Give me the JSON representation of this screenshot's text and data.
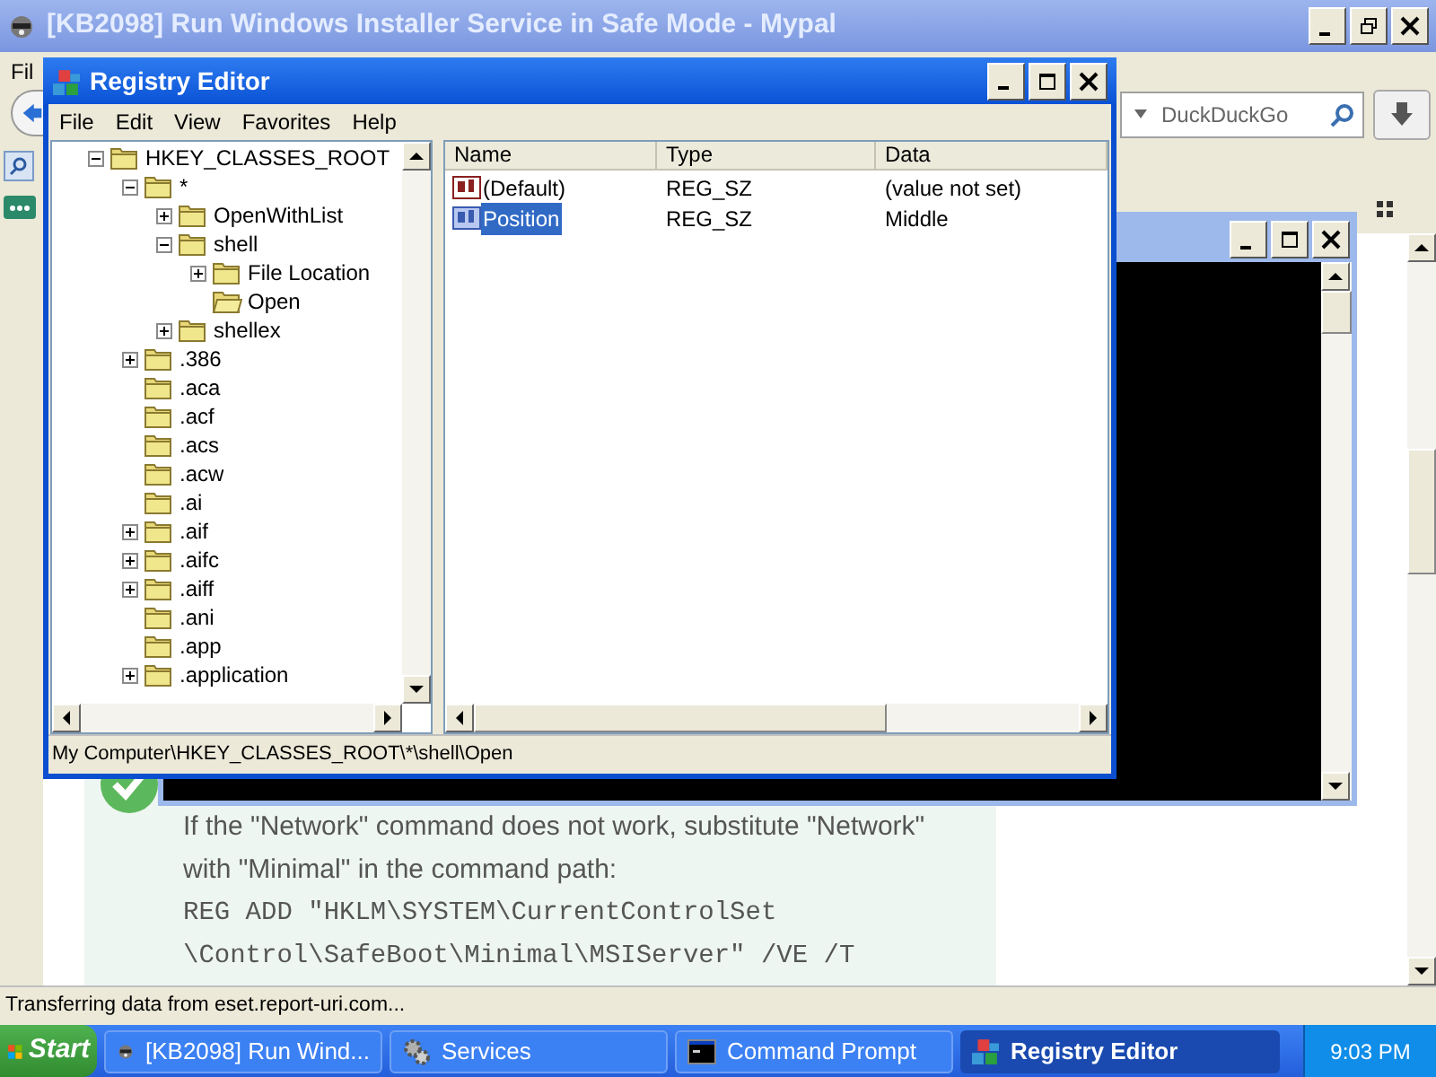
{
  "browser": {
    "title": "[KB2098] Run Windows Installer Service in Safe Mode - Mypal",
    "menu": [
      "Fil"
    ],
    "search": {
      "placeholder": "DuckDuckGo"
    },
    "article": {
      "paragraph": "If the \"Network\" command does not work, substitute \"Network\" with \"Minimal\" in the command path:",
      "code_lines": [
        "REG ADD \"HKLM\\SYSTEM\\CurrentControlSet",
        "\\Control\\SafeBoot\\Minimal\\MSIServer\" /VE /T"
      ]
    },
    "status_bar": "Transferring data from eset.report-uri.com..."
  },
  "registry_editor": {
    "title": "Registry Editor",
    "menu": [
      "File",
      "Edit",
      "View",
      "Favorites",
      "Help"
    ],
    "tree": [
      {
        "label": "HKEY_CLASSES_ROOT",
        "kind": "expanded",
        "children": [
          {
            "label": "*",
            "kind": "expanded",
            "children": [
              {
                "label": "OpenWithList",
                "kind": "collapsed"
              },
              {
                "label": "shell",
                "kind": "expanded",
                "children": [
                  {
                    "label": "File Location",
                    "kind": "collapsed"
                  },
                  {
                    "label": "Open",
                    "kind": "open_leaf"
                  }
                ]
              },
              {
                "label": "shellex",
                "kind": "collapsed"
              }
            ]
          },
          {
            "label": ".386",
            "kind": "collapsed"
          },
          {
            "label": ".aca",
            "kind": "leaf"
          },
          {
            "label": ".acf",
            "kind": "leaf"
          },
          {
            "label": ".acs",
            "kind": "leaf"
          },
          {
            "label": ".acw",
            "kind": "leaf"
          },
          {
            "label": ".ai",
            "kind": "leaf"
          },
          {
            "label": ".aif",
            "kind": "collapsed"
          },
          {
            "label": ".aifc",
            "kind": "collapsed"
          },
          {
            "label": ".aiff",
            "kind": "collapsed"
          },
          {
            "label": ".ani",
            "kind": "leaf"
          },
          {
            "label": ".app",
            "kind": "leaf"
          },
          {
            "label": ".application",
            "kind": "collapsed"
          }
        ]
      }
    ],
    "columns": [
      "Name",
      "Type",
      "Data"
    ],
    "values": [
      {
        "name": "(Default)",
        "type": "REG_SZ",
        "data": "(value not set)",
        "selected": false
      },
      {
        "name": "Position",
        "type": "REG_SZ",
        "data": "Middle",
        "selected": true
      }
    ],
    "status_bar": "My Computer\\HKEY_CLASSES_ROOT\\*\\shell\\Open"
  },
  "taskbar": {
    "start": "Start",
    "tasks": [
      {
        "label": "[KB2098] Run Wind...",
        "kind": "browser",
        "selected": false
      },
      {
        "label": "Services",
        "kind": "services",
        "selected": false
      },
      {
        "label": "Command Prompt",
        "kind": "console",
        "selected": false
      },
      {
        "label": "Registry Editor",
        "kind": "registry",
        "selected": true
      }
    ],
    "clock": "9:03 PM"
  }
}
